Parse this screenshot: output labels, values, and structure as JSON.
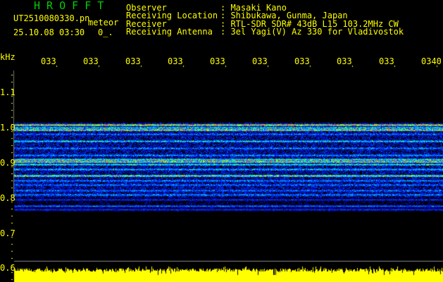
{
  "app_title": "H R O F F T",
  "file": {
    "name": "UT2510080330.pn",
    "mode": "meteor",
    "datetime": "25.10.08 03:30",
    "count": "0_."
  },
  "info": {
    "labels": [
      "Observer",
      "Receiving Location",
      "Receiver",
      "Receiving Antenna"
    ],
    "values": [
      ": Masaki Kano",
      ": Shibukawa, Gunma, Japan",
      ": RTL-SDR SDR# 43dB L15 103.2MHz CW",
      ": 3el Yagi(V) Az 330 for Vladivostok"
    ]
  },
  "axis": {
    "y_unit": "kHz",
    "y_ticks": [
      "1.1",
      "1.0",
      "0.9",
      "0.8",
      "0.7",
      "0.6"
    ],
    "x_ticks": [
      "0331",
      "0332",
      "0333",
      "0334",
      "0335",
      "0336",
      "0337",
      "0338",
      "0339",
      "0340"
    ]
  },
  "colors": {
    "text": "#ffff00",
    "title": "#00d000",
    "signal_peak": "#ff2060",
    "noise_bar": "#ffff00"
  }
}
